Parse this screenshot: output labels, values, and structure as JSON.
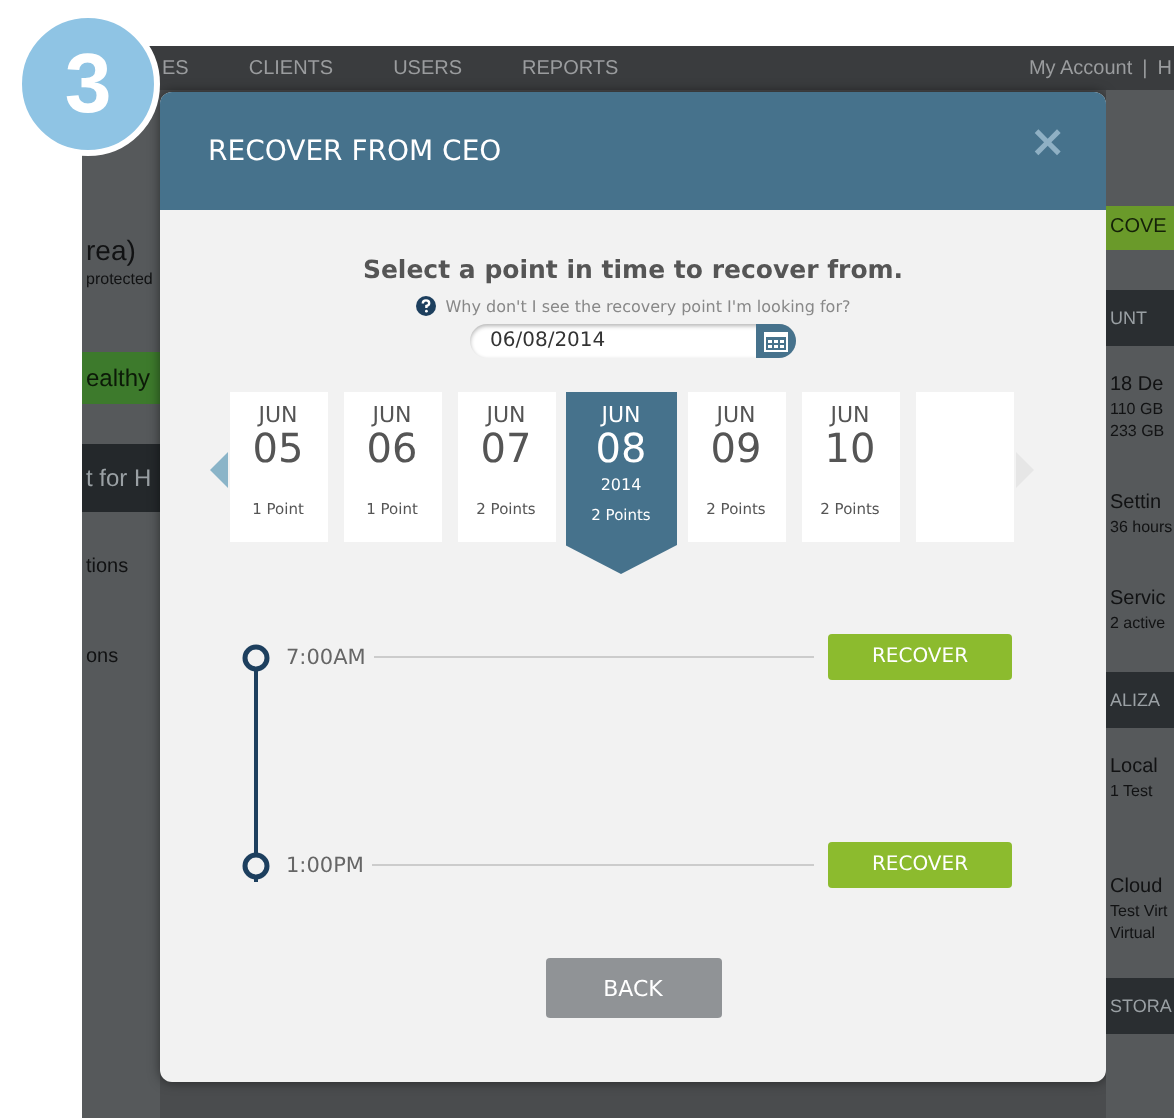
{
  "step_badge": "3",
  "nav": {
    "items": [
      "ES",
      "CLIENTS",
      "USERS",
      "REPORTS"
    ],
    "account": "My Account",
    "separator": "|",
    "cut": "H"
  },
  "left_panel": [
    {
      "kind": "heading",
      "text": "rea)"
    },
    {
      "kind": "small",
      "text": "protected"
    },
    {
      "kind": "green",
      "text": "ealthy"
    },
    {
      "kind": "dark",
      "text": "t for H"
    },
    {
      "kind": "link",
      "text": "tions"
    },
    {
      "kind": "link",
      "text": "ons"
    }
  ],
  "right_panel": [
    {
      "kind": "green",
      "text": "COVE"
    },
    {
      "kind": "dark",
      "text": "UNT"
    },
    {
      "kind": "heading",
      "text": "18 De"
    },
    {
      "kind": "small",
      "text": "110 GB"
    },
    {
      "kind": "small",
      "text": "233 GB"
    },
    {
      "kind": "heading",
      "text": "Settin"
    },
    {
      "kind": "small",
      "text": "36 hours"
    },
    {
      "kind": "heading",
      "text": "Servic"
    },
    {
      "kind": "small",
      "text": "2 active"
    },
    {
      "kind": "dark",
      "text": "ALIZA"
    },
    {
      "kind": "heading",
      "text": "Local"
    },
    {
      "kind": "small",
      "text": "1 Test"
    },
    {
      "kind": "heading",
      "text": "Cloud"
    },
    {
      "kind": "small",
      "text": "Test Virt"
    },
    {
      "kind": "small",
      "text": "Virtual"
    },
    {
      "kind": "dark",
      "text": "STORA"
    }
  ],
  "modal": {
    "title": "RECOVER FROM CEO",
    "close": "×",
    "prompt": "Select a point in time to recover from.",
    "help": "Why don't I see the recovery point I'm looking for?",
    "date_value": "06/08/2014",
    "previous_disabled": false,
    "next_disabled": true,
    "days": [
      {
        "kind": "date",
        "month": "JUN",
        "day": "05",
        "points": "1 Point",
        "selected": false
      },
      {
        "kind": "date",
        "month": "JUN",
        "day": "06",
        "points": "1 Point",
        "selected": false
      },
      {
        "kind": "date",
        "month": "JUN",
        "day": "07",
        "points": "2 Points",
        "selected": false
      },
      {
        "kind": "date",
        "month": "JUN",
        "day": "08",
        "year": "2014",
        "points": "2 Points",
        "selected": true
      },
      {
        "kind": "date",
        "month": "JUN",
        "day": "09",
        "points": "2 Points",
        "selected": false
      },
      {
        "kind": "date",
        "month": "JUN",
        "day": "10",
        "points": "2 Points",
        "selected": false
      },
      {
        "kind": "blank",
        "selected": false
      }
    ],
    "recovery_points": [
      {
        "time": "7:00AM",
        "button": "RECOVER"
      },
      {
        "time": "1:00PM",
        "button": "RECOVER"
      }
    ],
    "back": "BACK"
  }
}
